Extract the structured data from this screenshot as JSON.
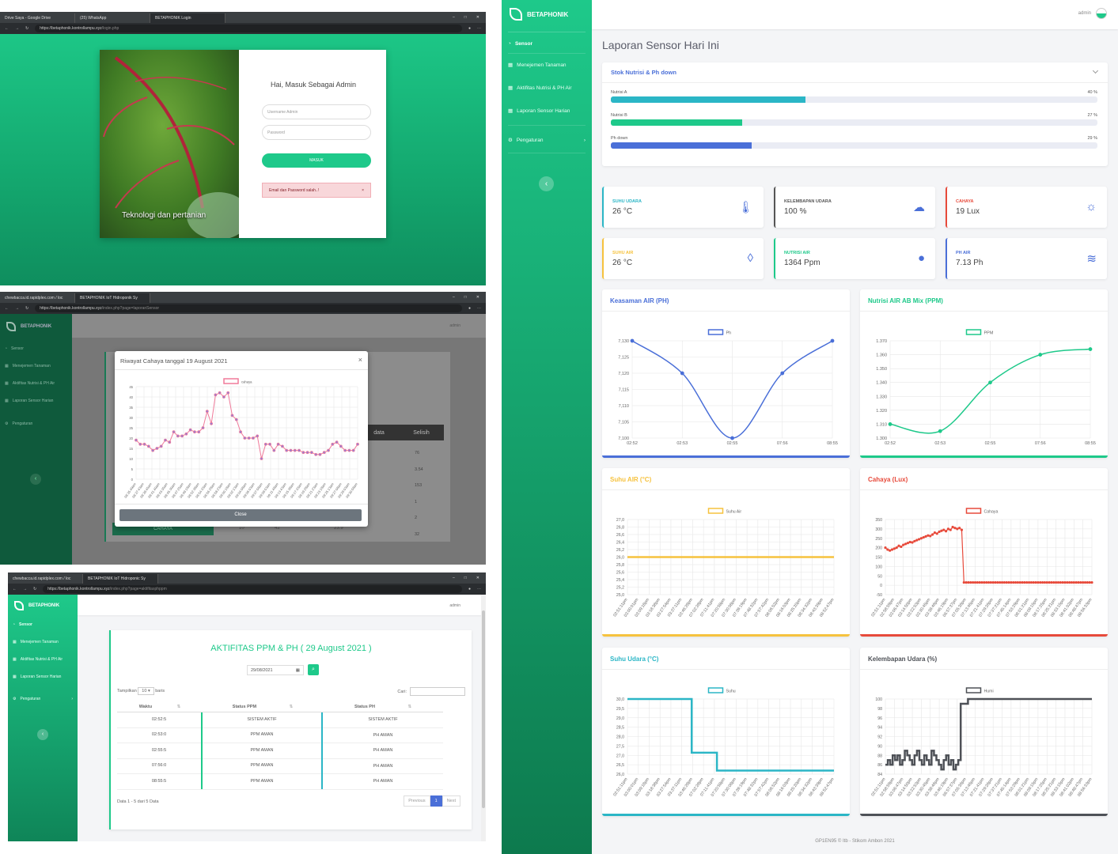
{
  "login": {
    "tabs": [
      {
        "label": "Drive Saya - Google Drive"
      },
      {
        "label": "(25) WhatsApp"
      },
      {
        "label": "BETAPHONIK Login"
      }
    ],
    "url": {
      "host": "https://betaphonik.kontrollampu.xyz",
      "path": "/login.php"
    },
    "image_caption": "Teknologi dan pertanian",
    "heading": "Hai, Masuk Sebagai Admin",
    "username_placeholder": "Username Admin",
    "password_placeholder": "Password",
    "submit_label": "MASUK",
    "error": "Email dan Password salah..!",
    "close_glyph": "×"
  },
  "modal_shot": {
    "tabs": [
      {
        "label": "chewbacca.id.rapidplex.com / loc"
      },
      {
        "label": "BETAPHONIK IoT Hidroponik Sy"
      }
    ],
    "url": {
      "host": "https://betaphonik.kontrollampu.xyz",
      "path": "/index.php?page=laporanSensor"
    },
    "brand": "BETAPHONIK",
    "user": "admin",
    "nav": [
      {
        "label": "Sensor"
      },
      {
        "label": "Menejemen Tanaman"
      },
      {
        "label": "Aktifitas Nutrisi & PH Air"
      },
      {
        "label": "Laporan Sensor Harian"
      },
      {
        "label": "Pengaturan"
      }
    ],
    "modal": {
      "title": "Riwayat Cahaya tanggal 19 August 2021",
      "close_glyph": "×",
      "button": "Close",
      "legend": "cahaya"
    },
    "bg_table": {
      "headers": [
        "data",
        "Selisih"
      ],
      "values": [
        "76",
        "3.54",
        "153",
        "1",
        "2",
        "32"
      ],
      "footer_label": "CAHAYA",
      "footer_vals": [
        "10",
        "42",
        "23.9"
      ]
    }
  },
  "aktifitas": {
    "tabs": [
      {
        "label": "chewbacca.id.rapidplex.com / loc"
      },
      {
        "label": "BETAPHONIK IoT Hidroponic Sy"
      }
    ],
    "url": {
      "host": "https://betaphonik.kontrollampu.xyz",
      "path": "/index.php?page=aktifitasphppm"
    },
    "brand": "BETAPHONIK",
    "user": "admin",
    "nav": [
      {
        "label": "Sensor"
      },
      {
        "label": "Menejemen Tanaman"
      },
      {
        "label": "Aktifitas Nutrisi & PH Air"
      },
      {
        "label": "Laporan Sensor Harian"
      },
      {
        "label": "Pengaturan"
      }
    ],
    "title": "AKTIFITAS PPM & PH ( 29 August 2021 )",
    "date_value": "29/08/2021",
    "show_label": "Tampilkan",
    "show_value": "10",
    "show_suffix": "baris",
    "search_label": "Cari:",
    "columns": [
      "Waktu",
      "Status PPM",
      "Status PH"
    ],
    "rows": [
      {
        "waktu": "02:52:5",
        "ppm": "SISTEM AKTIF",
        "ph": "SISTEM AKTIF"
      },
      {
        "waktu": "02:53:0",
        "ppm": "PPM AMAN",
        "ph": "PH AMAN"
      },
      {
        "waktu": "02:55:5",
        "ppm": "PPM AMAN",
        "ph": "PH AMAN"
      },
      {
        "waktu": "07:56:0",
        "ppm": "PPM AMAN",
        "ph": "PH AMAN"
      },
      {
        "waktu": "08:55:5",
        "ppm": "PPM AMAN",
        "ph": "PH AMAN"
      }
    ],
    "info": "Data 1 - 5 dari 5 Data",
    "pager": {
      "prev": "Previous",
      "page": "1",
      "next": "Next"
    }
  },
  "dashboard": {
    "brand": "BETAPHONIK",
    "user": "admin",
    "nav": [
      {
        "label": "Sensor"
      },
      {
        "label": "Menejemen Tanaman"
      },
      {
        "label": "Aktifitas Nutrisi & PH Air"
      },
      {
        "label": "Laporan Sensor Harian"
      },
      {
        "label": "Pengaturan"
      }
    ],
    "page_title": "Laporan Sensor Hari Ini",
    "stock": {
      "title": "Stok Nutrisi & Ph down",
      "items": [
        {
          "label": "Nutrisi A",
          "percent_text": "40 %",
          "fraction": 0.4,
          "color": "#2bb6c6"
        },
        {
          "label": "Nutrisi B",
          "percent_text": "27 %",
          "fraction": 0.27,
          "color": "#1ec98a"
        },
        {
          "label": "Ph down",
          "percent_text": "29 %",
          "fraction": 0.29,
          "color": "#4a6fd8"
        }
      ]
    },
    "stats": [
      {
        "label": "SUHU UDARA",
        "value": "26 °C",
        "icon": "thermometer-icon",
        "color": "#2bb6c6"
      },
      {
        "label": "KELEMBAPAN UDARA",
        "value": "100 %",
        "icon": "cloud-wind-icon",
        "color": "#555555"
      },
      {
        "label": "CAHAYA",
        "value": "19 Lux",
        "icon": "sun-icon",
        "color": "#e74a3b"
      },
      {
        "label": "SUHU AIR",
        "value": "26 °C",
        "icon": "water-drop-outline-icon",
        "color": "#f6c23e"
      },
      {
        "label": "NUTRISI AIR",
        "value": "1364 Ppm",
        "icon": "water-drop-icon",
        "color": "#1ec98a"
      },
      {
        "label": "PH AIR",
        "value": "7.13 Ph",
        "icon": "waves-icon",
        "color": "#4a6fd8"
      }
    ],
    "footer": "GP1EN95 © Itb - Stikom Ambon 2021"
  },
  "chart_data": [
    {
      "id": "ph",
      "type": "line",
      "title": "Keasaman AIR (PH)",
      "color": "#4a6fd8",
      "series": [
        {
          "name": "Ph",
          "values": [
            7.13,
            7.12,
            7.1,
            7.12,
            7.13
          ]
        }
      ],
      "categories": [
        "02:52",
        "02:53",
        "02:55",
        "07:56",
        "08:55"
      ],
      "ylim": [
        7.1,
        7.13
      ],
      "yticks": [
        "7,100",
        "7,105",
        "7,110",
        "7,115",
        "7,120",
        "7,125",
        "7,130"
      ],
      "smooth": true,
      "grid": true,
      "legend": "top"
    },
    {
      "id": "ppm",
      "type": "line",
      "title": "Nutrisi AIR AB Mix (PPM)",
      "color": "#1ec98a",
      "series": [
        {
          "name": "PPM",
          "values": [
            1.31,
            1.305,
            1.34,
            1.36,
            1.364
          ]
        }
      ],
      "categories": [
        "02:52",
        "02:53",
        "02:55",
        "07:56",
        "08:55"
      ],
      "ylim": [
        1.3,
        1.37
      ],
      "yticks": [
        "1.300",
        "1.310",
        "1.320",
        "1.330",
        "1.340",
        "1.350",
        "1.360",
        "1.370"
      ],
      "smooth": true,
      "grid": true,
      "legend": "top"
    },
    {
      "id": "suhuair",
      "type": "line",
      "title": "Suhu AIR (°C)",
      "color": "#f6c23e",
      "series": [
        {
          "name": "Suhu Air",
          "values": [
            26,
            26,
            26,
            26,
            26,
            26,
            26,
            26,
            26,
            26,
            26,
            26,
            26,
            26,
            26,
            26,
            26,
            26,
            26,
            26,
            26,
            26,
            26,
            26,
            26,
            26,
            26,
            26
          ]
        }
      ],
      "categories": [
        "02:51:11pm",
        "03:00:01pm",
        "03:09:18pm",
        "03:18:38pm",
        "03:27:54pm",
        "03:37:11pm",
        "03:46:28pm",
        "07:02:28pm",
        "07:11:41pm",
        "07:20:58pm",
        "07:30:08pm",
        "07:39:19pm",
        "07:48:32pm",
        "07:57:42pm",
        "08:06:52pm",
        "08:16:03pm",
        "08:25:20pm",
        "08:34:32pm",
        "08:43:39pm",
        "08:52:47pm"
      ],
      "ylim": [
        25.0,
        27.0
      ],
      "yticks": [
        "25,0",
        "25,2",
        "25,4",
        "25,6",
        "25,8",
        "26,0",
        "26,2",
        "26,4",
        "26,6",
        "26,8",
        "27,0"
      ],
      "step": false,
      "grid": true,
      "legend": "top"
    },
    {
      "id": "cahaya",
      "type": "line",
      "title": "Cahaya (Lux)",
      "color": "#e74a3b",
      "series": [
        {
          "name": "Cahaya",
          "values": [
            200,
            190,
            185,
            190,
            195,
            200,
            210,
            205,
            215,
            220,
            225,
            230,
            228,
            235,
            240,
            245,
            250,
            255,
            260,
            265,
            262,
            270,
            280,
            275,
            285,
            290,
            295,
            288,
            300,
            295,
            310,
            305,
            300,
            305,
            295,
            15,
            15,
            15,
            15,
            15,
            15,
            15,
            15,
            15,
            15,
            15,
            15,
            15,
            15,
            15,
            15,
            15,
            15,
            15,
            15,
            15,
            15,
            15,
            15,
            15,
            15,
            15,
            15,
            15,
            15,
            15,
            15,
            15,
            15,
            15,
            15,
            15,
            15,
            15,
            15,
            15,
            15,
            15,
            15,
            15,
            15,
            15,
            15,
            15,
            15,
            15,
            15,
            15,
            15,
            15,
            15,
            15,
            15
          ]
        }
      ],
      "categories": [
        "02:51:11pm",
        "02:58:59pm",
        "03:06:47pm",
        "03:14:50pm",
        "03:22:53pm",
        "03:30:45pm",
        "03:38:46pm",
        "03:46:19pm",
        "06:57:37pm",
        "07:05:36pm",
        "07:13:46pm",
        "07:21:41pm",
        "07:29:26pm",
        "07:37:21pm",
        "07:45:14pm",
        "07:53:29pm",
        "08:01:21pm",
        "08:09:15pm",
        "08:17:25pm",
        "08:25:21pm",
        "08:33:15pm",
        "08:41:02pm",
        "08:48:47pm",
        "08:56:33pm"
      ],
      "ylim": [
        -50,
        350
      ],
      "yticks": [
        "-50",
        "0",
        "50",
        "100",
        "150",
        "200",
        "250",
        "300",
        "350"
      ],
      "markers": true,
      "grid": true,
      "legend": "top"
    },
    {
      "id": "suhuudara",
      "type": "line",
      "title": "Suhu Udara (°C)",
      "color": "#2bb6c6",
      "series": [
        {
          "name": "Suhu",
          "values": [
            30,
            30,
            30,
            30,
            30,
            30,
            30,
            30,
            30,
            30,
            30,
            30,
            30,
            30,
            30,
            30,
            30,
            30,
            30,
            30,
            30,
            30,
            30,
            30,
            30,
            30,
            30,
            30,
            27,
            27,
            27,
            27,
            27,
            27,
            27,
            27,
            27,
            27,
            27,
            26,
            26,
            26,
            26,
            26,
            26,
            26,
            26,
            26,
            26,
            26,
            26,
            26,
            26,
            26,
            26,
            26,
            26,
            26,
            26,
            26,
            26,
            26,
            26,
            26,
            26,
            26,
            26,
            26,
            26,
            26,
            26,
            26,
            26,
            26,
            26,
            26,
            26,
            26,
            26,
            26,
            26,
            26,
            26,
            26,
            26,
            26,
            26,
            26,
            26,
            26,
            26
          ]
        }
      ],
      "categories": [
        "02:51:11pm",
        "03:00:01pm",
        "03:09:18pm",
        "03:18:38pm",
        "03:27:54pm",
        "03:37:11pm",
        "03:46:28pm",
        "07:02:28pm",
        "07:11:41pm",
        "07:20:58pm",
        "07:30:08pm",
        "07:39:19pm",
        "07:48:32pm",
        "07:57:42pm",
        "08:06:52pm",
        "08:16:03pm",
        "08:25:20pm",
        "08:34:32pm",
        "08:43:39pm",
        "08:52:47pm"
      ],
      "ylim": [
        25.8,
        30.0
      ],
      "yticks": [
        "26,0",
        "26,5",
        "27,0",
        "27,5",
        "28,0",
        "28,5",
        "29,0",
        "29,5",
        "30,0"
      ],
      "step": true,
      "grid": true,
      "legend": "top"
    },
    {
      "id": "kelembapan",
      "type": "line",
      "title": "Kelembapan Udara (%)",
      "color": "#4e5157",
      "series": [
        {
          "name": "Humi",
          "values": [
            86,
            87,
            86,
            88,
            87,
            88,
            86,
            87,
            89,
            88,
            87,
            86,
            88,
            89,
            87,
            86,
            88,
            87,
            86,
            89,
            88,
            87,
            86,
            85,
            87,
            88,
            86,
            87,
            85,
            86,
            87,
            99,
            99,
            99,
            100,
            100,
            100,
            100,
            100,
            100,
            100,
            100,
            100,
            100,
            100,
            100,
            100,
            100,
            100,
            100,
            100,
            100,
            100,
            100,
            100,
            100,
            100,
            100,
            100,
            100,
            100,
            100,
            100,
            100,
            100,
            100,
            100,
            100,
            100,
            100,
            100,
            100,
            100,
            100,
            100,
            100,
            100,
            100,
            100,
            100,
            100,
            100,
            100,
            100,
            100,
            100
          ]
        }
      ],
      "categories": [
        "02:51:11pm",
        "02:58:59pm",
        "03:06:47pm",
        "03:14:50pm",
        "03:22:53pm",
        "03:30:45pm",
        "03:38:46pm",
        "03:46:19pm",
        "06:57:37pm",
        "07:05:36pm",
        "07:13:46pm",
        "07:21:41pm",
        "07:29:26pm",
        "07:37:21pm",
        "07:45:14pm",
        "07:53:29pm",
        "08:01:21pm",
        "08:09:15pm",
        "08:17:25pm",
        "08:25:21pm",
        "08:33:15pm",
        "08:41:02pm",
        "08:48:47pm",
        "08:56:33pm"
      ],
      "ylim": [
        84,
        100
      ],
      "yticks": [
        "84",
        "86",
        "88",
        "90",
        "92",
        "94",
        "96",
        "98",
        "100"
      ],
      "step": true,
      "grid": true,
      "legend": "top"
    },
    {
      "id": "riwayat",
      "type": "line",
      "title": "Riwayat Cahaya tanggal 19 August 2021",
      "color": "#f07a9a",
      "series": [
        {
          "name": "cahaya",
          "values": [
            19,
            17,
            17,
            16,
            14,
            15,
            16,
            19,
            18,
            23,
            21,
            21,
            22,
            24,
            23,
            23,
            25,
            33,
            27,
            41,
            42,
            40,
            42,
            31,
            29,
            23,
            20,
            20,
            20,
            21,
            10,
            17,
            17,
            14,
            17,
            16,
            14,
            14,
            14,
            14,
            13,
            13,
            13,
            12,
            12,
            13,
            14,
            17,
            18,
            16,
            14,
            14,
            14,
            17
          ]
        }
      ],
      "categories": [
        "08:35:49am",
        "08:37:43am",
        "08:39:45am",
        "08:41:40am",
        "08:43:35am",
        "08:45:30am",
        "08:47:25am",
        "08:49:18am",
        "08:52:38am",
        "08:54:33am",
        "08:56:28am",
        "08:58:23am",
        "09:00:18am",
        "09:02:13am",
        "09:04:08am",
        "09:06:03am",
        "09:07:58am",
        "09:09:53am",
        "09:11:48am",
        "09:13:43am",
        "09:15:38am",
        "09:17:33am",
        "09:19:28am",
        "09:21:23am",
        "09:23:18am",
        "09:25:13am",
        "09:27:08am",
        "09:29:03am",
        "09:30:58am"
      ],
      "ylim": [
        0,
        45
      ],
      "yticks": [
        "0",
        "5",
        "10",
        "15",
        "20",
        "25",
        "30",
        "35",
        "40",
        "45"
      ],
      "markers": true,
      "grid": true,
      "legend": "top"
    }
  ]
}
